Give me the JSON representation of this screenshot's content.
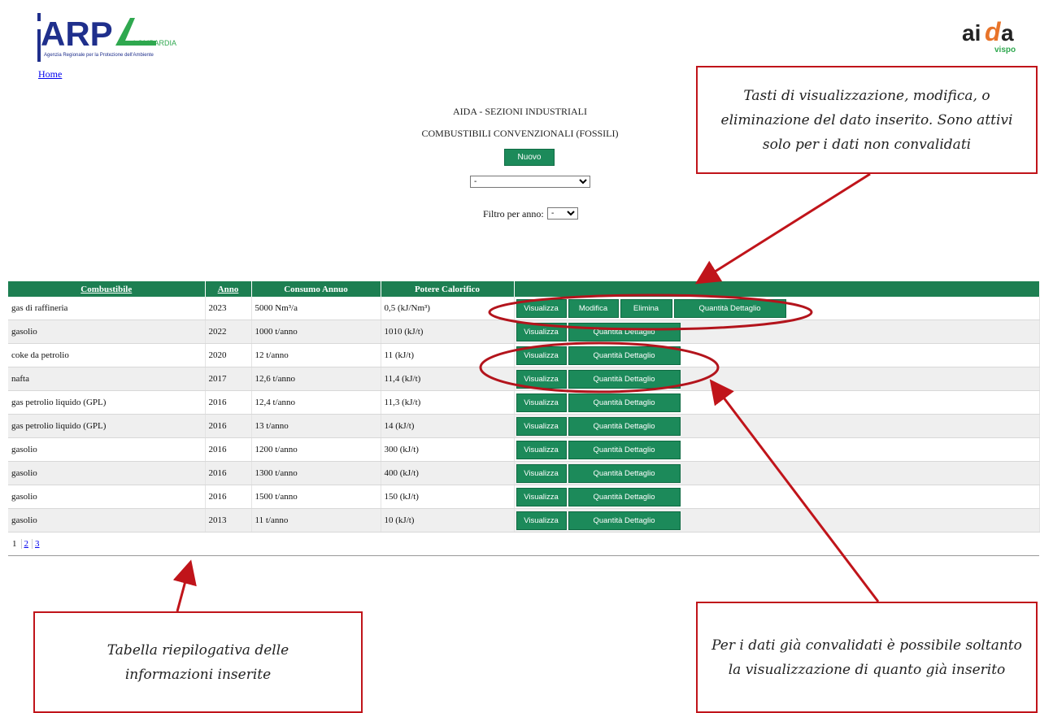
{
  "header": {
    "arpa_logo_text": "ARPA",
    "arpa_region": "LOMBARDIA",
    "arpa_tagline": "Agenzia Regionale per la Protezione dell'Ambiente",
    "aida_logo_text": "aida",
    "aida_sub": "vispo",
    "home_link": "Home",
    "title": "AIDA - SEZIONI INDUSTRIALI",
    "subtitle": "COMBUSTIBILI CONVENZIONALI (FOSSILI)",
    "new_button": "Nuovo",
    "main_select_value": "-",
    "filter_label": "Filtro per anno:",
    "year_select_value": "-"
  },
  "colors": {
    "green": "#1c8a5a",
    "header_green": "#1d7f52",
    "annotation_red": "#c0141a"
  },
  "table": {
    "headers": [
      "Combustibile",
      "Anno",
      "Consumo Annuo",
      "Potere Calorifico",
      ""
    ],
    "rows": [
      {
        "fuel": "gas di raffineria",
        "year": "2023",
        "consumption": "5000 Nm³/a",
        "calorific": "0,5 (kJ/Nm³)",
        "buttons": [
          "Visualizza",
          "Modifica",
          "Elimina",
          "Quantità Dettaglio"
        ]
      },
      {
        "fuel": "gasolio",
        "year": "2022",
        "consumption": "1000 t/anno",
        "calorific": "1010 (kJ/t)",
        "buttons": [
          "Visualizza",
          "Quantità Dettaglio"
        ]
      },
      {
        "fuel": "coke da petrolio",
        "year": "2020",
        "consumption": "12 t/anno",
        "calorific": "11 (kJ/t)",
        "buttons": [
          "Visualizza",
          "Quantità Dettaglio"
        ]
      },
      {
        "fuel": "nafta",
        "year": "2017",
        "consumption": "12,6 t/anno",
        "calorific": "11,4 (kJ/t)",
        "buttons": [
          "Visualizza",
          "Quantità Dettaglio"
        ]
      },
      {
        "fuel": "gas petrolio liquido (GPL)",
        "year": "2016",
        "consumption": "12,4 t/anno",
        "calorific": "11,3 (kJ/t)",
        "buttons": [
          "Visualizza",
          "Quantità Dettaglio"
        ]
      },
      {
        "fuel": "gas petrolio liquido (GPL)",
        "year": "2016",
        "consumption": "13 t/anno",
        "calorific": "14 (kJ/t)",
        "buttons": [
          "Visualizza",
          "Quantità Dettaglio"
        ]
      },
      {
        "fuel": "gasolio",
        "year": "2016",
        "consumption": "1200 t/anno",
        "calorific": "300 (kJ/t)",
        "buttons": [
          "Visualizza",
          "Quantità Dettaglio"
        ]
      },
      {
        "fuel": "gasolio",
        "year": "2016",
        "consumption": "1300 t/anno",
        "calorific": "400 (kJ/t)",
        "buttons": [
          "Visualizza",
          "Quantità Dettaglio"
        ]
      },
      {
        "fuel": "gasolio",
        "year": "2016",
        "consumption": "1500 t/anno",
        "calorific": "150 (kJ/t)",
        "buttons": [
          "Visualizza",
          "Quantità Dettaglio"
        ]
      },
      {
        "fuel": "gasolio",
        "year": "2013",
        "consumption": "11 t/anno",
        "calorific": "10 (kJ/t)",
        "buttons": [
          "Visualizza",
          "Quantità Dettaglio"
        ]
      }
    ],
    "pages": [
      "1",
      "2",
      "3"
    ],
    "current_page": "1"
  },
  "annotations": {
    "top": "Tasti di visualizzazione, modifica, o eliminazione del dato inserito. Sono attivi solo per i dati non convalidati",
    "left": "Tabella riepilogativa delle informazioni inserite",
    "right": "Per i dati già convalidati è possibile soltanto la visualizzazione di quanto già inserito"
  }
}
